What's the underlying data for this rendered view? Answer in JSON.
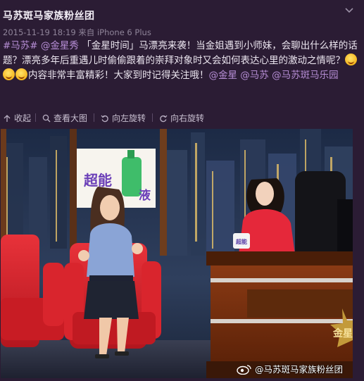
{
  "post": {
    "author": "马苏斑马家族粉丝团",
    "timestamp": "2015-11-19 18:19",
    "source_prefix": "来自",
    "device": "iPhone 6 Plus",
    "text_parts": [
      {
        "t": "#马苏#",
        "link": true
      },
      {
        "t": " ",
        "link": false
      },
      {
        "t": "@金星秀",
        "link": true
      },
      {
        "t": " 「金星时间」马漂亮来袭！当金姐遇到小师妹，会聊出什么样的话题？漂亮多年后重遇儿时偷偷跟着的崇拜对象时又会如何表达心里的激动之情呢？",
        "link": false
      },
      {
        "t": "EMOJI",
        "link": false
      },
      {
        "t": "EMOJI",
        "link": false
      },
      {
        "t": "EMOJI",
        "link": false
      },
      {
        "t": "内容非常丰富精彩！大家到时记得关注哦！",
        "link": false
      },
      {
        "t": "@金星",
        "link": true
      },
      {
        "t": " ",
        "link": false
      },
      {
        "t": "@马苏",
        "link": true
      },
      {
        "t": " ",
        "link": false
      },
      {
        "t": "@马苏斑马乐园",
        "link": true
      }
    ]
  },
  "toolbar": {
    "collapse": "收起",
    "view_large": "查看大图",
    "rotate_left": "向左旋转",
    "rotate_right": "向右旋转"
  },
  "image": {
    "billboard_text_1": "超能",
    "billboard_text_2": "液",
    "cup_text": "超能",
    "desk_logo": "金星",
    "watermark": "@马苏斑马家族粉丝团"
  },
  "colors": {
    "background": "#2b1c34",
    "link": "#b78ed6",
    "chair_red": "#d4212a"
  }
}
